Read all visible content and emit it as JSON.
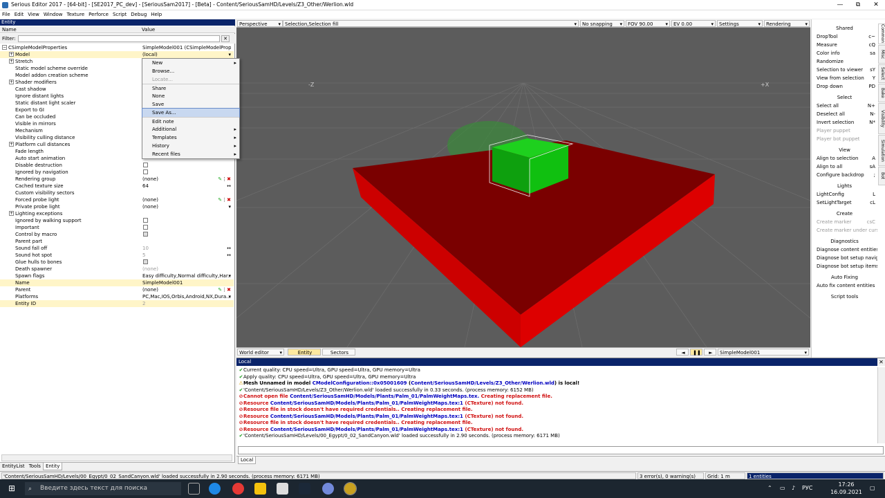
{
  "window": {
    "title": "Serious Editor 2017 - [64-bit] - [SE2017_PC_dev] - [SeriousSam2017] - [Beta] - Content/SeriousSamHD/Levels/Z3_Other/Werlion.wld",
    "minimize": "—",
    "maximize": "⧉",
    "close": "✕"
  },
  "menu": [
    "File",
    "Edit",
    "View",
    "Window",
    "Texture",
    "Perforce",
    "Script",
    "Debug",
    "Help"
  ],
  "left_panel": {
    "header": "Entity",
    "col_name": "Name",
    "col_value": "Value",
    "filter_label": "Filter:",
    "filter_value": "",
    "filter_clear": "✕",
    "rows": [
      {
        "name": "CSimpleModelProperties",
        "value": "SimpleModel001 (CSimpleModelProperties",
        "level": 0,
        "expander": "−"
      },
      {
        "name": "Model",
        "value": "(local)",
        "level": 1,
        "expander": "+",
        "highlight": true,
        "dropdown": true
      },
      {
        "name": "Stretch",
        "value": "",
        "level": 1,
        "expander": "+"
      },
      {
        "name": "Static model scheme override",
        "value": "",
        "level": 1
      },
      {
        "name": "Model addon creation scheme",
        "value": "",
        "level": 1
      },
      {
        "name": "Shader modifiers",
        "value": "",
        "level": 1,
        "expander": "+"
      },
      {
        "name": "Cast shadow",
        "value": "",
        "level": 1
      },
      {
        "name": "Ignore distant lights",
        "value": "",
        "level": 1
      },
      {
        "name": "Static distant light scaler",
        "value": "",
        "level": 1
      },
      {
        "name": "Export to GI",
        "value": "",
        "level": 1
      },
      {
        "name": "Can be occluded",
        "value": "",
        "level": 1
      },
      {
        "name": "Visible in mirrors",
        "value": "",
        "level": 1
      },
      {
        "name": "Mechanism",
        "value": "",
        "level": 1
      },
      {
        "name": "Visibility culling distance",
        "value": "",
        "level": 1
      },
      {
        "name": "Platform cull distances",
        "value": "",
        "level": 1,
        "expander": "+"
      },
      {
        "name": "Fade length",
        "value": "",
        "level": 1
      },
      {
        "name": "Auto start animation",
        "value": "",
        "level": 1
      },
      {
        "name": "Disable destruction",
        "value": "",
        "level": 1,
        "checkbox": true
      },
      {
        "name": "Ignored by navigation",
        "value": "",
        "level": 1,
        "checkbox": true
      },
      {
        "name": "Rendering group",
        "value": "(none)",
        "level": 1,
        "icons": true
      },
      {
        "name": "Cached texture size",
        "value": "64",
        "level": 1,
        "spin": true
      },
      {
        "name": "Custom visibility sectors",
        "value": "",
        "level": 1
      },
      {
        "name": "Forced probe light",
        "value": "(none)",
        "level": 1,
        "icons": true
      },
      {
        "name": "Private probe light",
        "value": "(none)",
        "level": 1,
        "dropdown": true
      },
      {
        "name": "Lighting exceptions",
        "value": "",
        "level": 1,
        "expander": "+"
      },
      {
        "name": "Ignored by walking support",
        "value": "",
        "level": 1,
        "checkbox": true
      },
      {
        "name": "Important",
        "value": "",
        "level": 1,
        "checkbox": true
      },
      {
        "name": "Control by macro",
        "value": "",
        "level": 1,
        "checkbox": true,
        "grey": true
      },
      {
        "name": "Parent part",
        "value": "",
        "level": 1
      },
      {
        "name": "Sound fall off",
        "value": "10",
        "level": 1,
        "dim": true,
        "spin": true
      },
      {
        "name": "Sound hot spot",
        "value": "5",
        "level": 1,
        "dim": true,
        "spin": true
      },
      {
        "name": "Glue hulls to bones",
        "value": "",
        "level": 1,
        "checkbox": true,
        "grey": true
      },
      {
        "name": "Death spawner",
        "value": "(none)",
        "level": 1,
        "dim": true
      },
      {
        "name": "Spawn flags",
        "value": "Easy difficulty,Normal difficulty,Har...",
        "level": 1,
        "dropdown": true
      },
      {
        "name": "Name",
        "value": "SimpleModel001",
        "level": 1,
        "highlight": true
      },
      {
        "name": "Parent",
        "value": "(none)",
        "level": 1,
        "icons": true
      },
      {
        "name": "Platforms",
        "value": "PC,Mac,IOS,Orbis,Android,NX,Dura...",
        "level": 1,
        "dropdown": true
      },
      {
        "name": "Entity ID",
        "value": "2",
        "level": 1,
        "dim": true,
        "highlight": true
      }
    ],
    "tabs": [
      "EntityList",
      "Tools",
      "Entity"
    ],
    "active_tab": "Entity"
  },
  "context_menu": [
    {
      "label": "New",
      "submenu": true
    },
    {
      "label": "Browse...",
      "submenu": false
    },
    {
      "label": "Locate...",
      "disabled": true
    },
    {
      "label": "Share",
      "separator": true
    },
    {
      "label": "None"
    },
    {
      "label": "Save"
    },
    {
      "label": "Save As...",
      "selected": true
    },
    {
      "label": "Edit note",
      "separator": true
    },
    {
      "label": "Additional",
      "submenu": true
    },
    {
      "label": "Templates",
      "submenu": true
    },
    {
      "label": "History",
      "submenu": true
    },
    {
      "label": "Recent files",
      "submenu": true
    }
  ],
  "viewport": {
    "toolbar": {
      "view_mode": "Perspective",
      "selection": "Selection,Selection fill",
      "snapping": "No snapping",
      "fov": "FOV 90.00",
      "ev": "EV  0.00",
      "settings": "Settings",
      "rendering": "Rendering"
    },
    "axis_neg_z": "-Z",
    "axis_pos_x": "+X",
    "floor_color": "#b00000",
    "cube_color": "#10b010",
    "grid_bg": "#5c5c5c"
  },
  "bottom_toolbar": {
    "mode": "World editor",
    "tab_entity": "Entity",
    "tab_sectors": "Sectors",
    "selected": "SimpleModel001",
    "prev": "◄",
    "pause": "❚❚",
    "next": "►"
  },
  "right_panel": {
    "tabs": [
      "Common",
      "Misc",
      "Select",
      "Bake",
      "Visibility",
      "Simulation",
      "Bot"
    ],
    "sections": [
      {
        "title": "Shared",
        "items": [
          {
            "label": "DropTool",
            "key": "c~"
          },
          {
            "label": "Measure",
            "key": "cQ"
          },
          {
            "label": "Color info",
            "key": "sa"
          },
          {
            "label": "Randomize",
            "key": ""
          },
          {
            "label": "Selection to viewer",
            "key": "sY"
          },
          {
            "label": "View from selection",
            "key": "Y"
          },
          {
            "label": "Drop down",
            "key": "PD"
          }
        ]
      },
      {
        "title": "Select",
        "items": [
          {
            "label": "Select all",
            "key": "N+"
          },
          {
            "label": "Deselect all",
            "key": "N-"
          },
          {
            "label": "Invert selection",
            "key": "N*"
          },
          {
            "label": "Player puppet",
            "key": "",
            "disabled": true
          },
          {
            "label": "Player bot puppet",
            "key": "",
            "disabled": true
          }
        ]
      },
      {
        "title": "View",
        "items": [
          {
            "label": "Align to selection",
            "key": "A"
          },
          {
            "label": "Align to all",
            "key": "sA"
          },
          {
            "label": "Configure backdrop",
            "key": ";"
          }
        ]
      },
      {
        "title": "Lights",
        "items": [
          {
            "label": "LightConfig",
            "key": "L"
          },
          {
            "label": "SetLightTarget",
            "key": "cL"
          }
        ]
      },
      {
        "title": "Create",
        "items": [
          {
            "label": "Create marker",
            "key": "csC",
            "disabled": true
          },
          {
            "label": "Create marker under cursor",
            "key": "",
            "disabled": true
          }
        ]
      },
      {
        "title": "Diagnostics",
        "items": [
          {
            "label": "Diagnose content entities",
            "key": ""
          },
          {
            "label": "Diagnose bot setup navigation",
            "key": ""
          },
          {
            "label": "Diagnose bot setup items",
            "key": ""
          }
        ]
      },
      {
        "title": "Auto Fixing",
        "items": [
          {
            "label": "Auto fix content entities",
            "key": ""
          }
        ]
      },
      {
        "title": "Script tools",
        "items": []
      }
    ]
  },
  "log": {
    "header": "Local",
    "lines": [
      {
        "type": "ok",
        "parts": [
          {
            "t": "Current quality: CPU speed=Ultra, GPU speed=Ultra, GPU memory=Ultra"
          }
        ]
      },
      {
        "type": "ok",
        "parts": [
          {
            "t": "Apply quality: CPU speed=Ultra, GPU speed=Ultra, GPU memory=Ultra"
          }
        ]
      },
      {
        "type": "warn",
        "parts": [
          {
            "t": "Mesh Unnamed in model "
          },
          {
            "t": "CModelConfiguration::0x05001609",
            "c": "blue"
          },
          {
            "t": " ("
          },
          {
            "t": "Content/SeriousSamHD/Levels/Z3_Other/Werlion.wld",
            "c": "blue"
          },
          {
            "t": ") is local!"
          }
        ]
      },
      {
        "type": "ok",
        "parts": [
          {
            "t": "'Content/SeriousSamHD/Levels/Z3_Other/Werlion.wld' loaded successfully in 0.33 seconds. (process memory: 6152 MB)"
          }
        ]
      },
      {
        "type": "err",
        "parts": [
          {
            "t": "Cannot open file "
          },
          {
            "t": "Content/SeriousSamHD/Models/Plants/Palm_01/PalmWeightMaps.tex.",
            "c": "blue"
          },
          {
            "t": " Creating replacement file."
          }
        ]
      },
      {
        "type": "err",
        "parts": [
          {
            "t": "Resource "
          },
          {
            "t": "Content/SeriousSamHD/Models/Plants/Palm_01/PalmWeightMaps.tex:1",
            "c": "blue"
          },
          {
            "t": " (CTexture) not found."
          }
        ]
      },
      {
        "type": "err",
        "parts": [
          {
            "t": "Resource file in stock doesn't have required credentials.. Creating replacement file."
          }
        ]
      },
      {
        "type": "err",
        "parts": [
          {
            "t": "Resource "
          },
          {
            "t": "Content/SeriousSamHD/Models/Plants/Palm_01/PalmWeightMaps.tex:1",
            "c": "blue"
          },
          {
            "t": " (CTexture) not found."
          }
        ]
      },
      {
        "type": "err",
        "parts": [
          {
            "t": "Resource file in stock doesn't have required credentials.. Creating replacement file."
          }
        ]
      },
      {
        "type": "err",
        "parts": [
          {
            "t": "Resource "
          },
          {
            "t": "Content/SeriousSamHD/Models/Plants/Palm_01/PalmWeightMaps.tex:1",
            "c": "blue"
          },
          {
            "t": " (CTexture) not found."
          }
        ]
      },
      {
        "type": "ok",
        "parts": [
          {
            "t": "'Content/SeriousSamHD/Levels/00_Egypt/0_02_SandCanyon.wld' loaded successfully in 2.90 seconds. (process memory: 6171 MB)"
          }
        ]
      }
    ],
    "input_value": "",
    "tab": "Local"
  },
  "statusbar": {
    "message": "'Content/SeriousSamHD/Levels/00_Egypt/0_02_SandCanyon.wld' loaded successfully in 2.90 seconds. (process memory: 6171 MB)",
    "errors": "3 error(s), 0 warning(s)",
    "grid": "Grid: 1 m",
    "entities": "1 entities"
  },
  "taskbar": {
    "search_placeholder": "Введите здесь текст для поиска",
    "lang": "РУС",
    "time": "17:26",
    "date": "16.09.2021"
  }
}
